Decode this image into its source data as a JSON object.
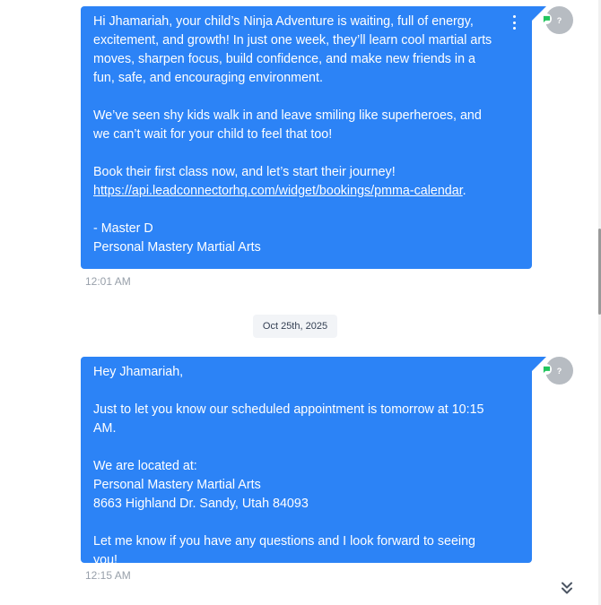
{
  "messages": [
    {
      "paragraphs": [
        "Hi Jhamariah, your child’s Ninja Adventure is waiting, full of energy, excitement, and growth! In just one week, they’ll learn cool martial arts moves, sharpen focus, build confidence, and make new friends in a fun, safe, and encouraging environment.",
        "We’ve seen shy kids walk in and leave smiling like superheroes, and we can’t wait for your child to feel that too!",
        "Book their first class now, and let’s start their journey!"
      ],
      "link_text": "https://api.leadconnectorhq.com/widget/bookings/pmma-calendar",
      "link_suffix": ".",
      "signature": "- Master D\nPersonal Mastery Martial Arts",
      "time": "12:01 AM",
      "avatar_initial": "?"
    },
    {
      "paragraphs": [
        "Hey Jhamariah,",
        "Just to let you know our scheduled appointment is tomorrow at 10:15 AM.",
        "We are located at:\nPersonal Mastery Martial Arts\n8663 Highland Dr. Sandy, Utah 84093",
        "Let me know if you have any questions and I look forward to seeing you!"
      ],
      "time": "12:15 AM",
      "avatar_initial": "?"
    }
  ],
  "date_separator": "Oct 25th, 2025",
  "icons": {
    "menu": "more-vertical-icon",
    "channel": "sms-chat-icon",
    "scroll": "chevrons-down-icon"
  },
  "colors": {
    "bubble": "#2c83f6",
    "avatar": "#b7bcc2",
    "channel_badge": "#22c55e",
    "timestamp": "#98a0aa"
  }
}
